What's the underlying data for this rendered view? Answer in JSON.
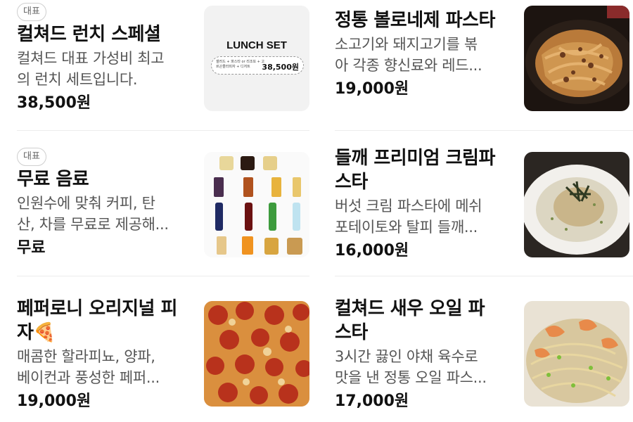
{
  "menu_items": [
    {
      "badge": "대표",
      "name_lines": [
        "컬쳐드 런치 스페셜"
      ],
      "desc_lines": [
        "컬쳐드 대표 가성비 최고",
        "의 런치 세트입니다."
      ],
      "price": "38,500원",
      "thumb": {
        "kind": "lunch-set",
        "title": "LUNCH SET",
        "items_text": "샐러드 + 파스타 or 리조또 + 고르곤졸라피자 + 디저트",
        "price": "38,500원"
      }
    },
    {
      "badge": "",
      "name_lines": [
        "정통 볼로네제 파스타"
      ],
      "desc_lines": [
        "소고기와 돼지고기를 볶",
        "아 각종 향신료와 레드..."
      ],
      "price": "19,000원",
      "thumb": {
        "kind": "pasta-bolognese"
      }
    },
    {
      "badge": "대표",
      "name_lines": [
        "무료 음료"
      ],
      "desc_lines": [
        "인원수에 맞춰 커피, 탄",
        "산, 차를 무료로 제공해..."
      ],
      "price": "무료",
      "thumb": {
        "kind": "drinks"
      }
    },
    {
      "badge": "",
      "name_lines": [
        "들깨 프리미엄 크림파",
        "스타"
      ],
      "desc_lines": [
        "버섯 크림 파스타에 메쉬",
        "포테이토와 탈피 들깨..."
      ],
      "price": "16,000원",
      "thumb": {
        "kind": "cream-pasta"
      }
    },
    {
      "badge": "",
      "name_lines": [
        "페퍼로니 오리지널 피",
        "자🍕"
      ],
      "desc_lines": [
        "매콤한 할라피뇨, 양파,",
        "베이컨과 풍성한 페퍼..."
      ],
      "price": "19,000원",
      "thumb": {
        "kind": "pepperoni-pizza"
      }
    },
    {
      "badge": "",
      "name_lines": [
        "컬쳐드 새우 오일 파",
        "스타"
      ],
      "desc_lines": [
        "3시간 끓인 야채 육수로",
        "맛을 낸 정통 오일 파스..."
      ],
      "price": "17,000원",
      "thumb": {
        "kind": "shrimp-oil-pasta"
      }
    }
  ]
}
